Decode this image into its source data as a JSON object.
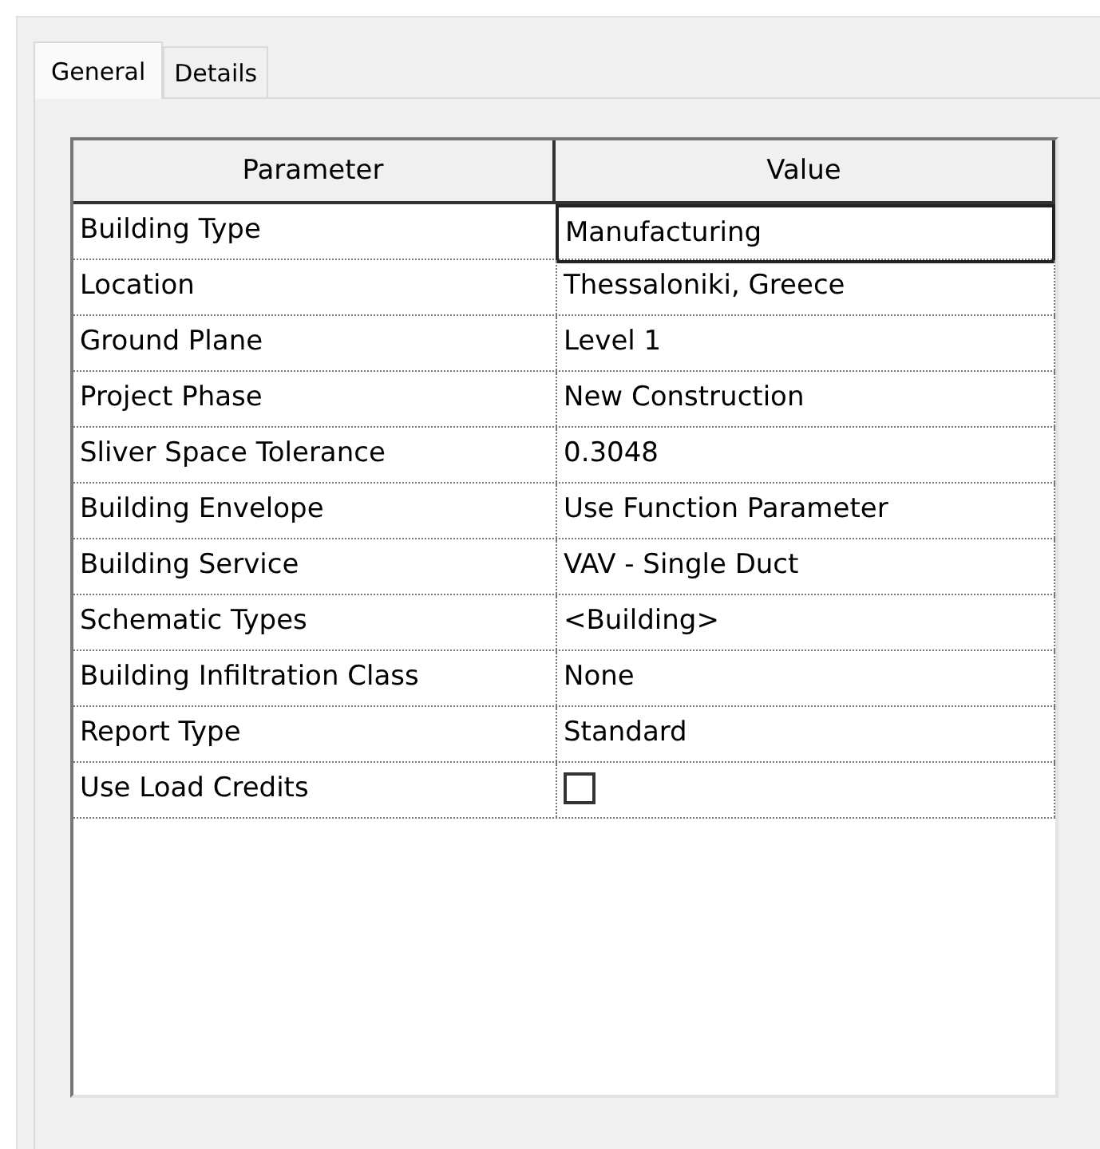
{
  "tabs": [
    {
      "label": "General",
      "selected": true
    },
    {
      "label": "Details",
      "selected": false
    }
  ],
  "table": {
    "columns": [
      "Parameter",
      "Value"
    ],
    "rows": [
      {
        "parameter": "Building Type",
        "kind": "text",
        "value": "Manufacturing",
        "selected": true
      },
      {
        "parameter": "Location",
        "kind": "text",
        "value": "Thessaloniki, Greece",
        "selected": false
      },
      {
        "parameter": "Ground Plane",
        "kind": "text",
        "value": "Level 1",
        "selected": false
      },
      {
        "parameter": "Project Phase",
        "kind": "text",
        "value": "New Construction",
        "selected": false
      },
      {
        "parameter": "Sliver Space Tolerance",
        "kind": "text",
        "value": "0.3048",
        "selected": false
      },
      {
        "parameter": "Building Envelope",
        "kind": "text",
        "value": "Use Function Parameter",
        "selected": false
      },
      {
        "parameter": "Building Service",
        "kind": "text",
        "value": "VAV - Single Duct",
        "selected": false
      },
      {
        "parameter": "Schematic Types",
        "kind": "text",
        "value": "<Building>",
        "selected": false
      },
      {
        "parameter": "Building Infiltration Class",
        "kind": "text",
        "value": "None",
        "selected": false
      },
      {
        "parameter": "Report Type",
        "kind": "text",
        "value": "Standard",
        "selected": false
      },
      {
        "parameter": "Use Load Credits",
        "kind": "checkbox",
        "checked": false,
        "selected": false
      }
    ]
  }
}
